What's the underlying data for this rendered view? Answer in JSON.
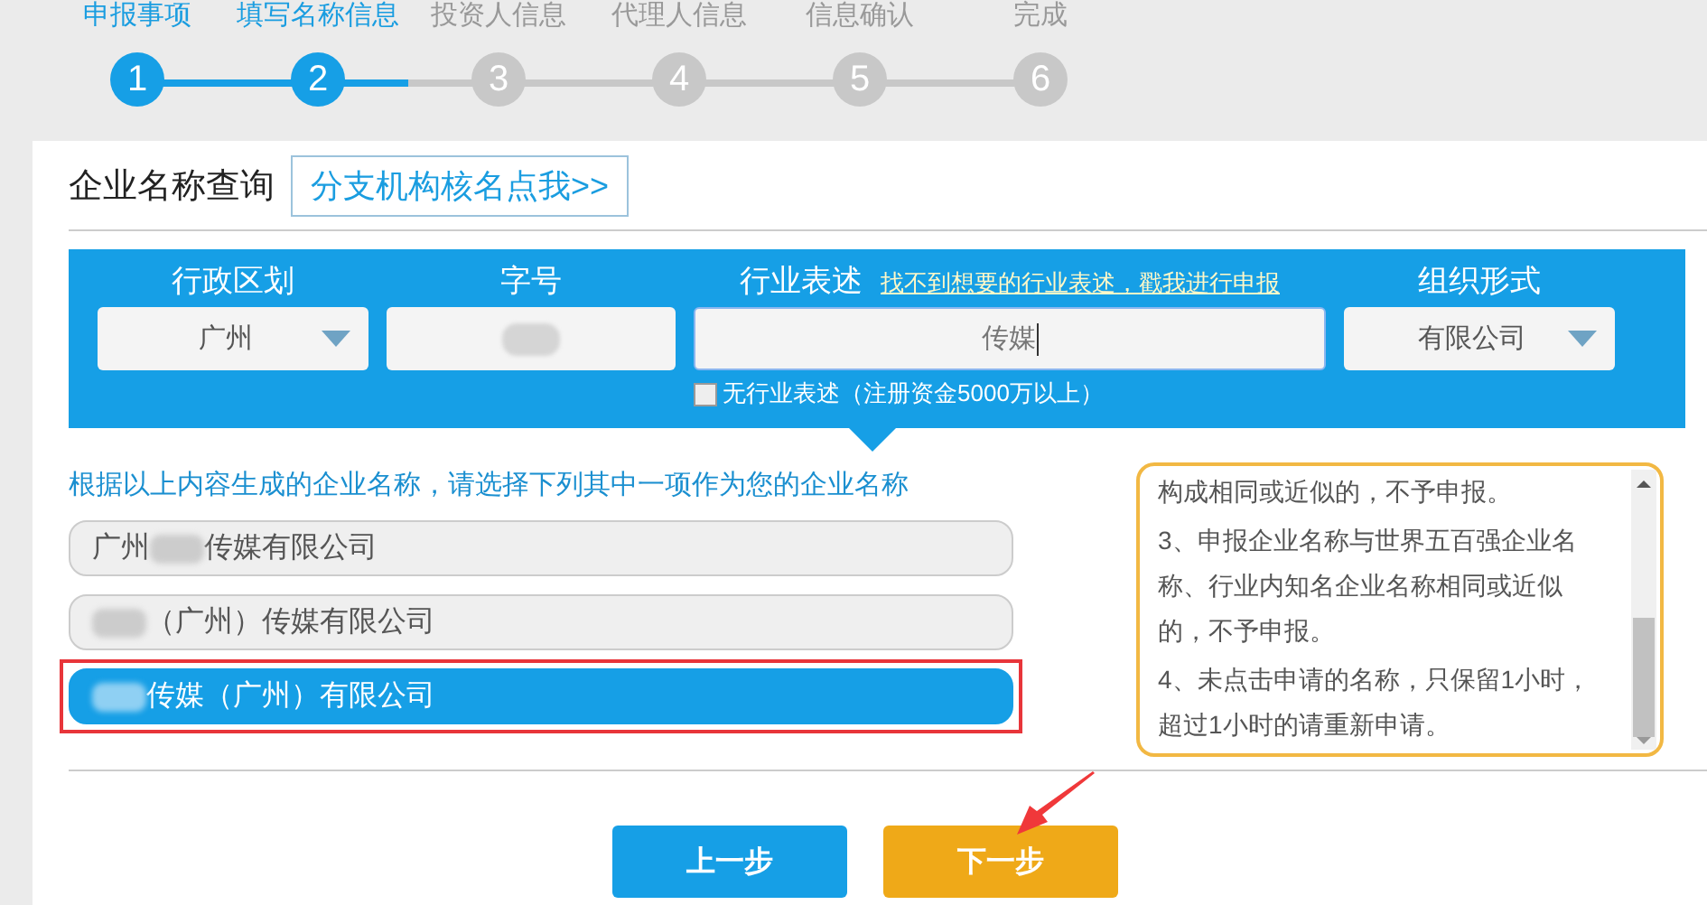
{
  "steps": [
    {
      "number": "1",
      "label": "申报事项",
      "done": true
    },
    {
      "number": "2",
      "label": "填写名称信息",
      "done": true
    },
    {
      "number": "3",
      "label": "投资人信息",
      "done": false
    },
    {
      "number": "4",
      "label": "代理人信息",
      "done": false
    },
    {
      "number": "5",
      "label": "信息确认",
      "done": false
    },
    {
      "number": "6",
      "label": "完成",
      "done": false
    }
  ],
  "query": {
    "title": "企业名称查询",
    "branch_link": "分支机构核名点我>>",
    "fields": [
      {
        "kind": "select",
        "label": "行政区划",
        "value": "广州"
      },
      {
        "kind": "redacted",
        "label": "字号"
      },
      {
        "kind": "input",
        "label": "行业表述",
        "link": "找不到想要的行业表述，戳我进行申报",
        "value": "传媒",
        "checkbox": {
          "label": "无行业表述（注册资金5000万以上）",
          "checked": false
        }
      },
      {
        "kind": "select",
        "label": "组织形式",
        "value": "有限公司"
      }
    ]
  },
  "instruction": "根据以上内容生成的企业名称，请选择下列其中一项作为您的企业名称",
  "options": [
    {
      "before": "广州",
      "after": "传媒有限公司",
      "selected": false,
      "highlighted": false
    },
    {
      "after": "（广州）传媒有限公司",
      "selected": false,
      "highlighted": false
    },
    {
      "after": "传媒（广州）有限公司",
      "selected": true,
      "highlighted": true
    }
  ],
  "notice": [
    "构成相同或近似的，不予申报。",
    "3、申报企业名称与世界五百强企业名称、行业内知名企业名称相同或近似的，不予申报。",
    "4、未点击申请的名称，只保留1小时，超过1小时的请重新申请。"
  ],
  "buttons": [
    {
      "kind": "prev",
      "label": "上一步",
      "annotated": false
    },
    {
      "kind": "next",
      "label": "下一步",
      "annotated": true
    }
  ]
}
